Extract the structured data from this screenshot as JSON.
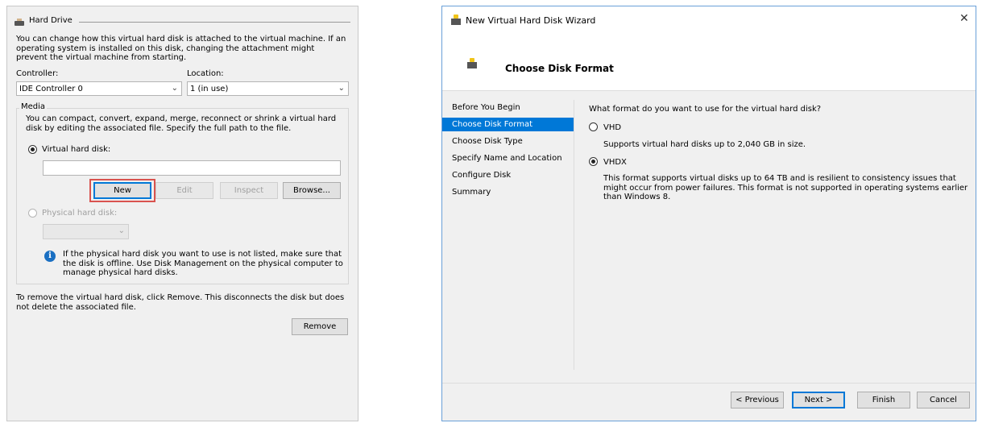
{
  "hard_drive": {
    "title": "Hard Drive",
    "intro": "You can change how this virtual hard disk is attached to the virtual machine. If an operating system is installed on this disk, changing the attachment might prevent the virtual machine from starting.",
    "controller_label": "Controller:",
    "controller_value": "IDE Controller 0",
    "location_label": "Location:",
    "location_value": "1 (in use)",
    "media_label": "Media",
    "media_text": "You can compact, convert, expand, merge, reconnect or shrink a virtual hard disk by editing the associated file. Specify the full path to the file.",
    "virtual_disk_label": "Virtual hard disk:",
    "virtual_disk_path": "",
    "buttons": {
      "new": "New",
      "edit": "Edit",
      "inspect": "Inspect",
      "browse": "Browse..."
    },
    "physical_disk_label": "Physical hard disk:",
    "physical_disk_value": "",
    "info_text": "If the physical hard disk you want to use is not listed, make sure that the disk is offline. Use Disk Management on the physical computer to manage physical hard disks.",
    "remove_text": "To remove the virtual hard disk, click Remove. This disconnects the disk but does not delete the associated file.",
    "remove_button": "Remove",
    "highlight_color": "#d9534f"
  },
  "wizard": {
    "window_title": "New Virtual Hard Disk Wizard",
    "heading": "Choose Disk Format",
    "steps": [
      "Before You Begin",
      "Choose Disk Format",
      "Choose Disk Type",
      "Specify Name and Location",
      "Configure Disk",
      "Summary"
    ],
    "active_step": "Choose Disk Format",
    "question": "What format do you want to use for the virtual hard disk?",
    "options": [
      {
        "label": "VHD",
        "description": "Supports virtual hard disks up to 2,040 GB in size.",
        "selected": false
      },
      {
        "label": "VHDX",
        "description": "This format supports virtual disks up to 64 TB and is resilient to consistency issues that might occur from power failures. This format is not supported in operating systems earlier than Windows 8.",
        "selected": true
      }
    ],
    "buttons": {
      "previous": "< Previous",
      "next": "Next >",
      "finish": "Finish",
      "cancel": "Cancel"
    },
    "close_glyph": "✕",
    "accent_color": "#0078d7"
  }
}
